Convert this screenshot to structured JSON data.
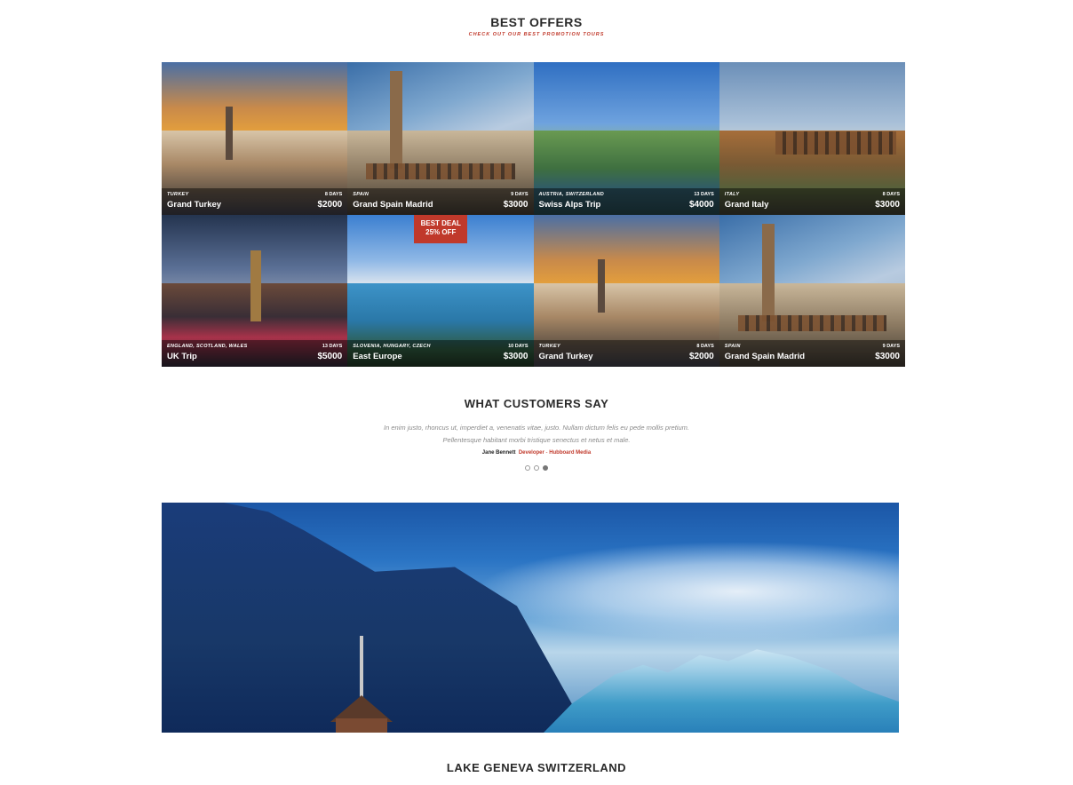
{
  "offers": {
    "title": "BEST OFFERS",
    "subtitle": "CHECK OUT OUR BEST PROMOTION TOURS",
    "tiles": [
      {
        "location": "TURKEY",
        "name": "Grand Turkey",
        "days": "8 DAYS",
        "price": "$2000",
        "scene": "sunset"
      },
      {
        "location": "SPAIN",
        "name": "Grand Spain Madrid",
        "days": "9 DAYS",
        "price": "$3000",
        "scene": "madrid"
      },
      {
        "location": "AUSTRIA, SWITZERLAND",
        "name": "Swiss Alps Trip",
        "days": "13 DAYS",
        "price": "$4000",
        "scene": "alps"
      },
      {
        "location": "ITALY",
        "name": "Grand Italy",
        "days": "8 DAYS",
        "price": "$3000",
        "scene": "italy"
      },
      {
        "location": "ENGLAND, SCOTLAND, WALES",
        "name": "UK Trip",
        "days": "13 DAYS",
        "price": "$5000",
        "scene": "uk"
      },
      {
        "location": "SLOVENIA, HUNGARY, CZECH",
        "name": "East Europe",
        "days": "10 DAYS",
        "price": "$3000",
        "scene": "lake",
        "badge": [
          "BEST DEAL",
          "25% OFF"
        ]
      },
      {
        "location": "TURKEY",
        "name": "Grand Turkey",
        "days": "8 DAYS",
        "price": "$2000",
        "scene": "sunset"
      },
      {
        "location": "SPAIN",
        "name": "Grand Spain Madrid",
        "days": "9 DAYS",
        "price": "$3000",
        "scene": "madrid"
      }
    ]
  },
  "testimonials": {
    "title": "WHAT CUSTOMERS SAY",
    "quote": "In enim justo, rhoncus ut, imperdiet a, venenatis vitae, justo. Nullam dictum felis eu pede mollis pretium. Pellentesque habitant morbi tristique senectus et netus et male.",
    "author": "Jane Bennett",
    "role": "Developer",
    "separator": "-",
    "company": "Hubboard Media",
    "active_dot": 2,
    "dot_count": 3
  },
  "hero": {
    "caption": "LAKE GENEVA SWITZERLAND"
  },
  "colors": {
    "accent": "#c0392b",
    "title": "#2a2a2a",
    "quote": "#8a8a8a"
  }
}
